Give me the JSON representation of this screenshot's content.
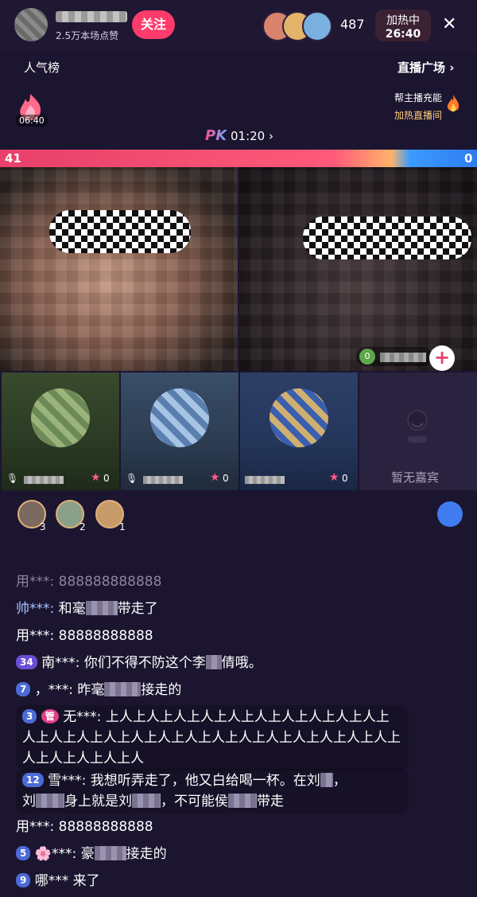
{
  "header": {
    "likes_text": "2.5万本场点赞",
    "follow_label": "关注",
    "viewer_count": "487",
    "heat_label": "加热中",
    "heat_time": "26:40",
    "close_icon": "close-icon"
  },
  "subbar": {
    "rank_label": "人气榜",
    "square_label": "直播广场 ›",
    "charge_text": "帮主播充能",
    "boost_text": "加热直播间",
    "timer": "06:40"
  },
  "pk": {
    "label": "PK",
    "time": "01:20 ›",
    "score_left": "41",
    "score_right": "0"
  },
  "guests": [
    {
      "score": "0"
    },
    {
      "score": "0"
    },
    {
      "score": "0"
    }
  ],
  "empty_seat": "暂无嘉宾",
  "fans": [
    {
      "rank": "3"
    },
    {
      "rank": "2"
    },
    {
      "rank": "1"
    }
  ],
  "chat": [
    {
      "user": "用***:",
      "text": "888888888888",
      "faded": true
    },
    {
      "user": "帅***:",
      "text": "和毫",
      "suffix": "带走了"
    },
    {
      "user": "用***:",
      "text": "88888888888"
    },
    {
      "badge": "34",
      "user": "南***:",
      "text": "你们不得不防这个李",
      "suffix": "倩哦。"
    },
    {
      "badge": "7",
      "user": "，***:",
      "text": "昨毫",
      "suffix": "接走的"
    },
    {
      "badge": "3",
      "tag": "管",
      "user": "无***:",
      "text": "上人上人上人上人上人上人上人上人上人上人上人上人上人上人上人上人上人上人上人上人上人上人上人上人上人上人上人上人上人"
    },
    {
      "badge": "12",
      "user": "雪***:",
      "text": "我想听弄走了，他又白给喝一杯。在刘",
      "suffix": "，",
      "line2a": "刘",
      "line2b": "身上就是刘",
      "line2c": "，不可能侯",
      "line2d": "带走"
    },
    {
      "user": "用***:",
      "text": "88888888888"
    },
    {
      "badge": "5",
      "user": "***:",
      "text": "豪",
      "suffix": "接走的"
    },
    {
      "badge": "9",
      "user": "哪***",
      "text": "来了"
    }
  ]
}
